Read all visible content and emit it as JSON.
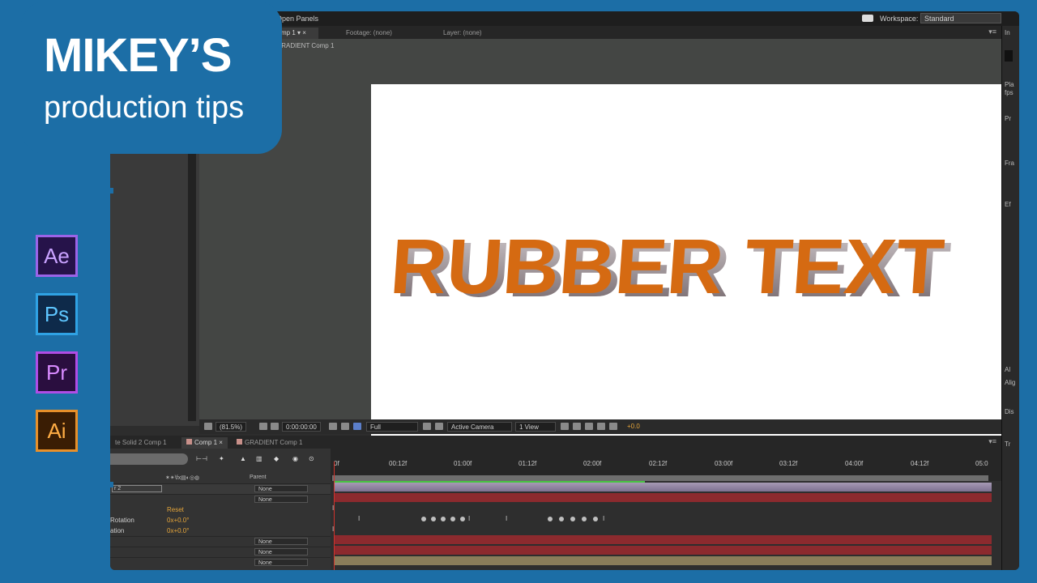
{
  "brand": {
    "title": "MIKEY’S",
    "subtitle": "production tips"
  },
  "apps": [
    {
      "label": "Ae",
      "bg": "#26134a",
      "border": "#9b64e8",
      "fg": "#c9a2ff"
    },
    {
      "label": "Ps",
      "bg": "#0e2a4a",
      "border": "#2fa2e4",
      "fg": "#5ec6ff"
    },
    {
      "label": "Pr",
      "bg": "#2a0e3f",
      "border": "#b04de6",
      "fg": "#d98bff"
    },
    {
      "label": "Ai",
      "bg": "#3a1d04",
      "border": "#e8902a",
      "fg": "#ffad45"
    }
  ],
  "app_window": {
    "menu": {
      "open_panels": "Open Panels",
      "workspace_label": "Workspace:",
      "workspace_value": "Standard"
    },
    "viewer_tabs": [
      {
        "label": "mp 1",
        "active": true
      },
      {
        "label": "Footage: (none)",
        "active": false
      },
      {
        "label": "Layer: (none)",
        "active": false
      }
    ],
    "breadcrumb": "GRADIENT Comp 1",
    "composition_text": "RUBBER TEXT",
    "viewer_toolbar": {
      "zoom": "(81.5%)",
      "timecode": "0:00:00:00",
      "resolution": "Full",
      "camera": "Active Camera",
      "view": "1 View",
      "exposure": "+0.0"
    },
    "timeline_tabs": [
      {
        "label": "te Solid 2 Comp 1",
        "active": false
      },
      {
        "label": "Comp 1",
        "active": true
      },
      {
        "label": "GRADIENT Comp 1",
        "active": false
      }
    ],
    "time_ruler": [
      "0f",
      "00:12f",
      "01:00f",
      "01:12f",
      "02:00f",
      "02:12f",
      "03:00f",
      "03:12f",
      "04:00f",
      "04:12f",
      "05:0"
    ],
    "columns": {
      "switches": "✶✴\\fx▤◐◎◍",
      "parent": "Parent"
    },
    "layers": [
      {
        "name": "r 2",
        "parent": "None"
      },
      {
        "name": "",
        "parent": "None"
      },
      {
        "name": "",
        "parent": "None"
      },
      {
        "name": "",
        "parent": "None"
      },
      {
        "name": "",
        "parent": "None"
      }
    ],
    "properties": [
      {
        "label": "",
        "value": "Reset"
      },
      {
        "label": "Rotation",
        "value": "0x+0.0°"
      },
      {
        "label": "ation",
        "value": "0x+0.0°"
      }
    ],
    "right_panel": [
      "In",
      "Pla",
      "fps",
      "Pr",
      "Fra",
      "Ef",
      "Al",
      "Alig",
      "Dis",
      "Tr"
    ],
    "colors": {
      "accent": "#e5a53a",
      "track_purple": "#8e7ea0",
      "track_red": "#8c2a2e",
      "track_olive": "#8a7d5a",
      "text_orange": "#d56a12"
    }
  }
}
